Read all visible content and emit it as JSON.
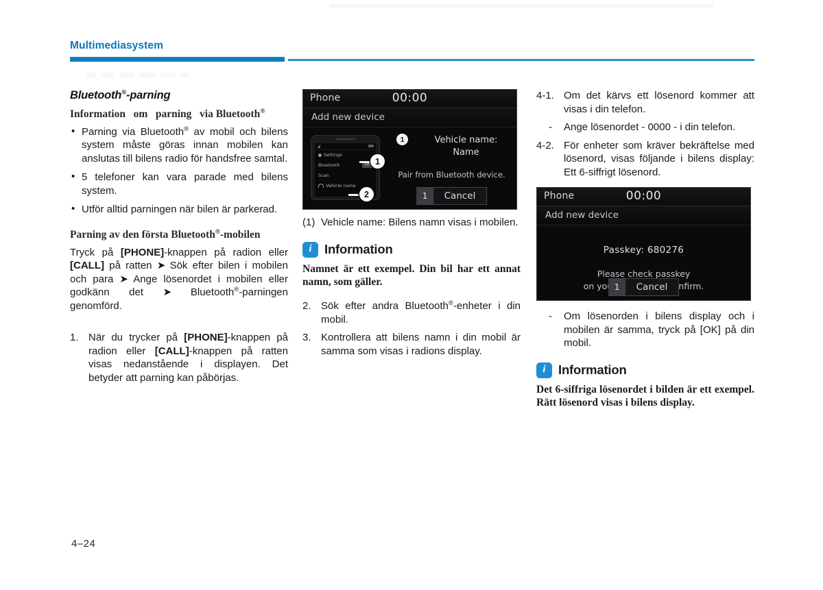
{
  "header": {
    "title": "Multimediasystem",
    "accent_color": "#0f7ec0"
  },
  "footer": {
    "page_number": "4–24"
  },
  "left_column": {
    "section_title": "Bluetooth®-parning",
    "sub_head_1": "Information om parning via Bluetooth®",
    "bullets": [
      "Parning via Bluetooth® av mobil och bilens system måste göras innan mobilen kan anslutas till bilens radio för handsfree samtal.",
      "5 telefoner kan vara parade med bilens system.",
      "Utför alltid parningen när bilen är parkerad."
    ],
    "sub_head_2": "Parning av den första Bluetooth®-mobilen",
    "paragraph": "Tryck på [PHONE]-knappen på radion eller [CALL] på ratten ➜ Sök efter bilen i mobilen och para ➜ Ange lösenordet i mobilen eller godkänn det ➜ Bluetooth®-parningen genomförd.",
    "step_1_marker": "1.",
    "step_1_text": "När du trycker på [PHONE]-knappen på radion eller [CALL]-knappen på ratten visas nedanstående i displayen. Det betyder att parning kan påbörjas."
  },
  "middle_column": {
    "head_unit_1": {
      "app_name": "Phone",
      "clock": "00:00",
      "screen_title": "Add new device",
      "callout_1": "1",
      "vehicle_name_label": "Vehicle name:",
      "vehicle_name_value": "Name",
      "pair_hint": "Pair from Bluetooth device.",
      "button_index": "1",
      "button_label": "Cancel",
      "phone_mock": {
        "row_settings": "Settings",
        "row_bluetooth": "Bluetooth",
        "bluetooth_state": "On",
        "row_scan": "Scan",
        "row_vehicle": "Vehicle name",
        "bubble_1": "1",
        "bubble_2": "2"
      }
    },
    "caption_marker": "(1)",
    "caption_text": "Vehicle name: Bilens namn visas i mobilen.",
    "information": {
      "icon": "info-icon",
      "title": "Information",
      "body": "Namnet är ett exempel. Din bil har ett annat namn, som gäller."
    },
    "step_2_marker": "2.",
    "step_2_text": "Sök efter andra Bluetooth®-enheter i din mobil.",
    "step_3_marker": "3.",
    "step_3_text": "Kontrollera att bilens namn i din mobil är samma som visas i radions display."
  },
  "right_column": {
    "step_41_marker": "4-1.",
    "step_41_text": "Om det kärvs ett lösenord kommer att visas i din telefon.",
    "dash_1_marker": "-",
    "dash_1_text": "Ange lösenordet - 0000 - i din telefon.",
    "step_42_marker": "4-2.",
    "step_42_text": "För enheter som kräver bekräftelse med lösenord, visas följande i bilens display: Ett 6-siffrigt lösenord.",
    "head_unit_2": {
      "app_name": "Phone",
      "clock": "00:00",
      "screen_title": "Add new device",
      "passkey_label": "Passkey: 680276",
      "message_line_1": "Please check passkey",
      "message_line_2": "on your device and confirm.",
      "button_index": "1",
      "button_label": "Cancel"
    },
    "dash_2_marker": "-",
    "dash_2_text": "Om lösenorden i bilens display och i mobilen är samma, tryck på [OK] på din mobil.",
    "information": {
      "icon": "info-icon",
      "title": "Information",
      "body": "Det 6-siffriga lösenordet i bilden är ett exempel. Rätt lösenord visas i bilens display."
    }
  }
}
